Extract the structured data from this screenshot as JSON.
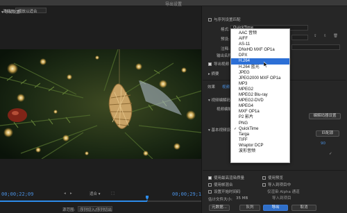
{
  "window": {
    "title": "导出设置"
  },
  "source": {
    "label": "源缩放:",
    "value": "缩放以适合"
  },
  "timeline": {
    "in_timecode": "00;00;22;09",
    "out_timecode": "00;00;29;14",
    "fit_label": "适合",
    "source_range_label": "源范围:",
    "source_range_value": "序列切入/序列切出",
    "progress": 0.73
  },
  "export_settings": {
    "section_title": "导出设置",
    "match_sequence_label": "与序列设置匹配",
    "format_label": "格式:",
    "format_value": "QuickTime",
    "preset_label": "预设:",
    "comments_label": "注释:",
    "output_name_label": "输出名称:",
    "export_video_label": "导出视频",
    "summary_label": "摘要"
  },
  "tabs": [
    "效果",
    "视频"
  ],
  "video_codec": {
    "section_title": "视频编解码器",
    "codec_label": "视频编解码器",
    "codec_settings_button": "编解码器设置"
  },
  "basic_video": {
    "section_title": "基本视频设置",
    "match_source_button": "匹配源",
    "value": "90"
  },
  "bottom_options": {
    "max_render_quality": "使用最高渲染质量",
    "use_previews": "使用预览",
    "use_frame_blending": "使用帧混合",
    "import_into_project": "导入到项目中",
    "set_start_timecode": "设置开始时间码",
    "render_alpha_only": "仅渲染 Alpha 通道",
    "estimated_size_label": "估计文件大小:",
    "estimated_size_value": "35 MB",
    "import_into_project2": "导入到项目",
    "metadata_button": "元数据...",
    "queue_button": "队列",
    "export_button": "导出",
    "cancel_button": "取消"
  },
  "format_dropdown": {
    "selected": "H.264",
    "checked": "QuickTime",
    "options": [
      "AAC 音频",
      "AIFF",
      "AS-11",
      "DNxHD MXF OP1a",
      "DPX",
      "H.264",
      "H.264 蓝光",
      "JPEG",
      "JPEG2000 MXF OP1a",
      "MP3",
      "MPEG2",
      "MPEG2 Blu-ray",
      "MPEG2-DVD",
      "MPEG4",
      "MXF OP1a",
      "P2 影片",
      "PNG",
      "QuickTime",
      "Targa",
      "TIFF",
      "Wraptor DCP",
      "波形音频"
    ]
  },
  "colors": {
    "accent": "#2c6fd6",
    "timecode": "#4a90e2",
    "panel": "#262626"
  }
}
